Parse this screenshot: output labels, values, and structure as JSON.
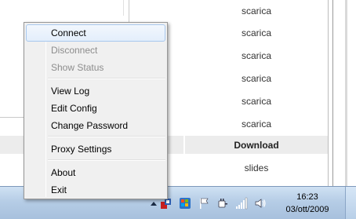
{
  "background_page": {
    "right_column_cells": [
      "scarica",
      "scarica",
      "scarica",
      "scarica",
      "scarica",
      "scarica"
    ],
    "download_header": "Download",
    "bottom_cell": "slides"
  },
  "context_menu": {
    "items": [
      {
        "label": "Connect",
        "state": "highlighted"
      },
      {
        "label": "Disconnect",
        "state": "disabled"
      },
      {
        "label": "Show Status",
        "state": "disabled"
      },
      {
        "label": "View Log",
        "state": "enabled"
      },
      {
        "label": "Edit Config",
        "state": "enabled"
      },
      {
        "label": "Change Password",
        "state": "enabled"
      },
      {
        "label": "Proxy Settings",
        "state": "enabled"
      },
      {
        "label": "About",
        "state": "enabled"
      },
      {
        "label": "Exit",
        "state": "enabled"
      }
    ]
  },
  "taskbar": {
    "tray_icons": [
      "show-hidden-icons-icon",
      "openvpn-tray-icon",
      "windows-update-icon",
      "action-center-flag-icon",
      "power-plug-icon",
      "network-signal-icon",
      "volume-speaker-icon"
    ],
    "clock": {
      "time": "16:23",
      "date": "03/ott/2009"
    }
  },
  "colors": {
    "menu_highlight_border": "#a8c8ee",
    "taskbar_top": "#cfe1f3",
    "taskbar_bottom": "#a7c0dd"
  }
}
